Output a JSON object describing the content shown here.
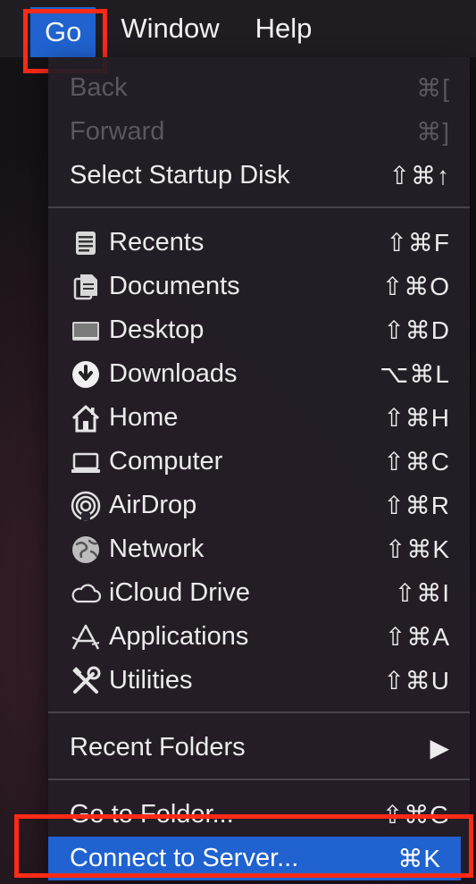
{
  "menubar": {
    "items": [
      {
        "label": "Go"
      },
      {
        "label": "Window"
      },
      {
        "label": "Help"
      }
    ]
  },
  "menu": {
    "back": {
      "label": "Back",
      "shortcut": "⌘["
    },
    "forward": {
      "label": "Forward",
      "shortcut": "⌘]"
    },
    "startup": {
      "label": "Select Startup Disk",
      "shortcut": "⇧⌘↑"
    },
    "places": [
      {
        "label": "Recents",
        "shortcut": "⇧⌘F",
        "icon": "recents-icon"
      },
      {
        "label": "Documents",
        "shortcut": "⇧⌘O",
        "icon": "documents-icon"
      },
      {
        "label": "Desktop",
        "shortcut": "⇧⌘D",
        "icon": "desktop-icon"
      },
      {
        "label": "Downloads",
        "shortcut": "⌥⌘L",
        "icon": "downloads-icon"
      },
      {
        "label": "Home",
        "shortcut": "⇧⌘H",
        "icon": "home-icon"
      },
      {
        "label": "Computer",
        "shortcut": "⇧⌘C",
        "icon": "computer-icon"
      },
      {
        "label": "AirDrop",
        "shortcut": "⇧⌘R",
        "icon": "airdrop-icon"
      },
      {
        "label": "Network",
        "shortcut": "⇧⌘K",
        "icon": "network-icon"
      },
      {
        "label": "iCloud Drive",
        "shortcut": "⇧⌘I",
        "icon": "icloud-icon"
      },
      {
        "label": "Applications",
        "shortcut": "⇧⌘A",
        "icon": "applications-icon"
      },
      {
        "label": "Utilities",
        "shortcut": "⇧⌘U",
        "icon": "utilities-icon"
      }
    ],
    "recent_folders": {
      "label": "Recent Folders",
      "submenu_glyph": "▶"
    },
    "go_to_folder": {
      "label": "Go to Folder...",
      "shortcut": "⇧⌘G"
    },
    "connect_to_server": {
      "label": "Connect to Server...",
      "shortcut": "⌘K"
    }
  },
  "colors": {
    "highlight": "#1f62d0",
    "annotation": "#ff2a17"
  }
}
